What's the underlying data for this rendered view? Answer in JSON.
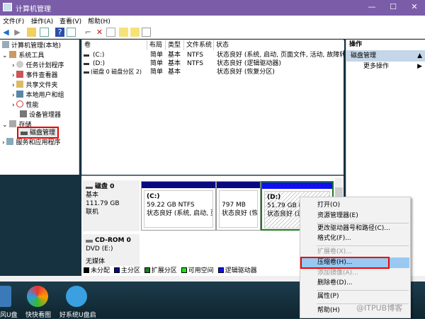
{
  "window": {
    "title": "计算机管理",
    "minimize": "—",
    "maximize": "☐",
    "close": "✕"
  },
  "menu": [
    "文件(F)",
    "操作(A)",
    "查看(V)",
    "帮助(H)"
  ],
  "tree": {
    "root": "计算机管理(本地)",
    "system_tools": "系统工具",
    "items": [
      "任务计划程序",
      "事件查看器",
      "共享文件夹",
      "本地用户和组",
      "性能",
      "设备管理器"
    ],
    "storage": "存储",
    "disk_mgmt": "磁盘管理",
    "services": "服务和应用程序"
  },
  "table": {
    "headers": [
      "卷",
      "布局",
      "类型",
      "文件系统",
      "状态"
    ],
    "rows": [
      [
        "(C:)",
        "简单",
        "基本",
        "NTFS",
        "状态良好 (系统, 启动, 页面文件, 活动, 故障转储"
      ],
      [
        "(D:)",
        "简单",
        "基本",
        "NTFS",
        "状态良好 (逻辑驱动器)"
      ],
      [
        "(磁盘 0 磁盘分区 2)",
        "简单",
        "基本",
        "",
        "状态良好 (恢复分区)"
      ]
    ]
  },
  "actions": {
    "header": "操作",
    "section": "磁盘管理",
    "more": "更多操作"
  },
  "disk0": {
    "name": "磁盘 0",
    "type": "基本",
    "size": "111.79 GB",
    "status": "联机",
    "partitions": [
      {
        "label": "(C:)",
        "size": "59.22 GB NTFS",
        "status": "状态良好 (系统, 启动, 页"
      },
      {
        "label": "",
        "size": "797 MB",
        "status": "状态良好 (恢复"
      },
      {
        "label": "(D:)",
        "size": "51.79 GB NTFS",
        "status": "状态良好 (逻"
      }
    ]
  },
  "cdrom": {
    "name": "CD-ROM 0",
    "type": "DVD (E:)",
    "status": "无媒体"
  },
  "legend": [
    "未分配",
    "主分区",
    "扩展分区",
    "可用空间",
    "逻辑驱动器"
  ],
  "legend_colors": [
    "#000000",
    "#0a0a80",
    "#1e7b1e",
    "#22dd22",
    "#1010ee"
  ],
  "context_menu": [
    "打开(O)",
    "资源管理器(E)",
    "更改驱动器号和路径(C)...",
    "格式化(F)...",
    "扩展卷(X)...",
    "压缩卷(H)...",
    "添加镜像(A)...",
    "删除卷(D)...",
    "属性(P)",
    "帮助(H)"
  ],
  "desktop": [
    "风U盘",
    "快快看图",
    "好系统U盘启"
  ],
  "watermark": "@ITPUB博客"
}
